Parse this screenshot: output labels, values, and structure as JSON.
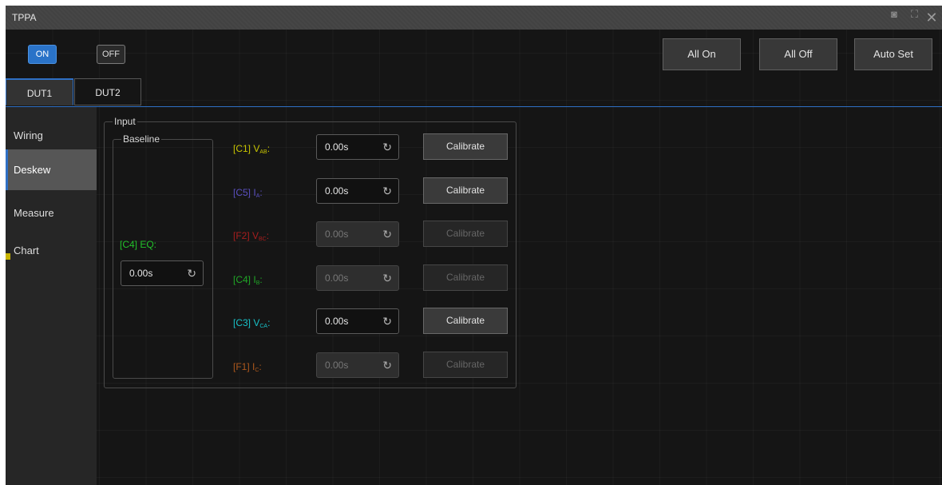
{
  "window": {
    "title": "TPPA"
  },
  "titlebar_icons": [
    "camera-icon",
    "expand-icon",
    "close-icon"
  ],
  "power": {
    "on_label": "ON",
    "off_label": "OFF",
    "state": "on"
  },
  "toolbar": {
    "all_on": "All On",
    "all_off": "All Off",
    "auto_set": "Auto Set"
  },
  "tabs": [
    {
      "label": "DUT1",
      "active": true
    },
    {
      "label": "DUT2",
      "active": false
    }
  ],
  "sidebar": {
    "items": [
      {
        "label": "Wiring",
        "active": false
      },
      {
        "label": "Deskew",
        "active": true
      },
      {
        "label": "Measure",
        "active": false
      },
      {
        "label": "Chart",
        "active": false
      }
    ]
  },
  "input": {
    "legend": "Input",
    "baseline": {
      "legend": "Baseline",
      "channel_label": "[C4] EQ:",
      "value": "0.00s",
      "color": "#22c12a"
    },
    "channels": [
      {
        "prefix": "[C1] V",
        "sub": "AB",
        "suffix": ":",
        "color": "#c8c400",
        "value": "0.00s",
        "enabled": true,
        "button": "Calibrate"
      },
      {
        "prefix": "[C5] I",
        "sub": "A",
        "suffix": ":",
        "color": "#5a4fc0",
        "value": "0.00s",
        "enabled": true,
        "button": "Calibrate"
      },
      {
        "prefix": "[F2] V",
        "sub": "BC",
        "suffix": ":",
        "color": "#c02020",
        "value": "0.00s",
        "enabled": false,
        "button": "Calibrate"
      },
      {
        "prefix": "[C4] I",
        "sub": "B",
        "suffix": ":",
        "color": "#22c12a",
        "value": "0.00s",
        "enabled": false,
        "button": "Calibrate"
      },
      {
        "prefix": "[C3] V",
        "sub": "CA",
        "suffix": ":",
        "color": "#18c2c8",
        "value": "0.00s",
        "enabled": true,
        "button": "Calibrate"
      },
      {
        "prefix": "[F1] I",
        "sub": "C",
        "suffix": ":",
        "color": "#c8641e",
        "value": "0.00s",
        "enabled": false,
        "button": "Calibrate"
      }
    ]
  },
  "colors": {
    "accent": "#2e6fc4",
    "on_button": "#2a73c8",
    "background": "#151515"
  }
}
